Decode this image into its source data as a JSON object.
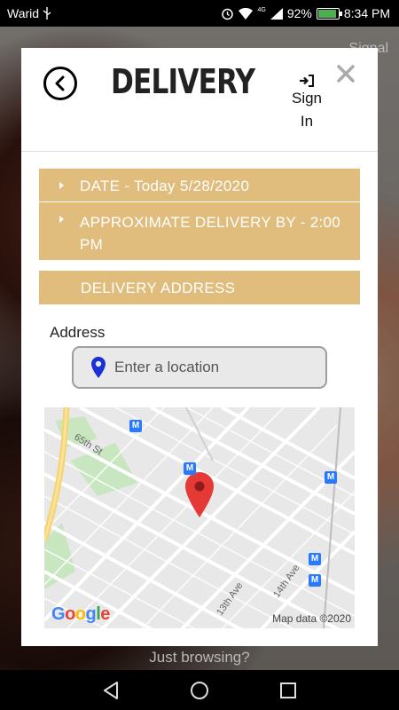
{
  "status_bar": {
    "carrier": "Warid",
    "battery_percent": "92%",
    "time": "8:34 PM",
    "network_badge": "4G",
    "battery_level": 0.92,
    "icons": [
      "usb-icon",
      "alarm-icon",
      "wifi-icon",
      "signal-icon",
      "battery-icon"
    ]
  },
  "background": {
    "sign_in_label": "Signal",
    "browse_label": "Just browsing?"
  },
  "modal": {
    "title": "DELIVERY",
    "sign_in_label": "Sign In",
    "date_label": "DATE - Today 5/28/2020",
    "approx_label": "APPROXIMATE DELIVERY BY - 2:00 PM",
    "address_bar_label": "DELIVERY ADDRESS",
    "address_field_label": "Address",
    "address_placeholder": "Enter a location",
    "accent_color": "#e0bd7c"
  },
  "map": {
    "credit": "Map data ©2020",
    "logo": "Google",
    "streets": [
      "65th St",
      "13th Ave",
      "14th Ave"
    ],
    "transit_marker": "M"
  },
  "nav_bar": {
    "icons": [
      "back-icon",
      "home-icon",
      "recents-icon"
    ]
  }
}
